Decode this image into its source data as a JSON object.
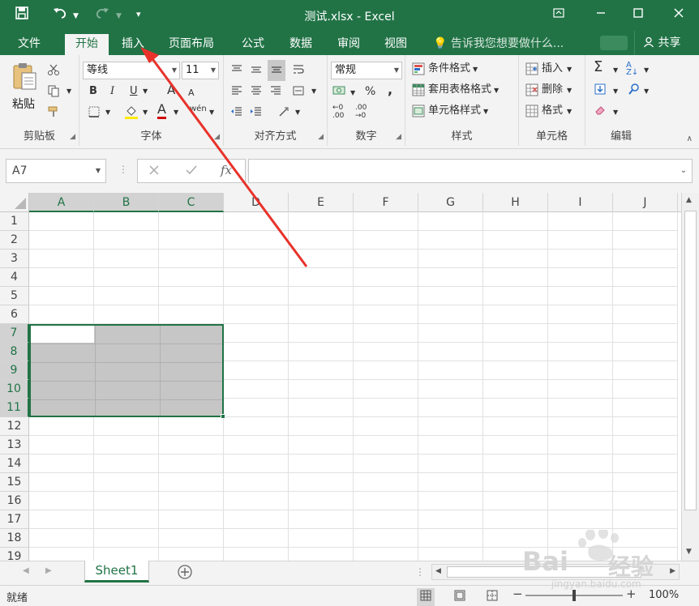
{
  "window": {
    "title": "测试.xlsx - Excel"
  },
  "tabs": [
    {
      "label": "文件"
    },
    {
      "label": "开始",
      "active": true
    },
    {
      "label": "插入"
    },
    {
      "label": "页面布局"
    },
    {
      "label": "公式"
    },
    {
      "label": "数据"
    },
    {
      "label": "审阅"
    },
    {
      "label": "视图"
    }
  ],
  "tellme": {
    "placeholder": "告诉我您想要做什么..."
  },
  "share": {
    "label": "共享"
  },
  "ribbon": {
    "clipboard": {
      "label": "剪贴板",
      "paste": "粘贴"
    },
    "font": {
      "label": "字体",
      "family": "等线",
      "size": "11",
      "bold": "B",
      "italic": "I",
      "underline": "U",
      "grow": "A",
      "shrink": "A",
      "fontcolor": "A",
      "phonetic": "wén"
    },
    "alignment": {
      "label": "对齐方式"
    },
    "number": {
      "label": "数字",
      "format": "常规",
      "percent": "%",
      "comma": ","
    },
    "styles": {
      "label": "样式",
      "conditional": "条件格式",
      "table": "套用表格格式",
      "cell": "单元格样式"
    },
    "cells": {
      "label": "单元格",
      "insert": "插入",
      "delete": "删除",
      "format": "格式"
    },
    "editing": {
      "label": "编辑"
    }
  },
  "formula_bar": {
    "namebox": "A7",
    "fx": "fx",
    "value": ""
  },
  "columns": [
    "A",
    "B",
    "C",
    "D",
    "E",
    "F",
    "G",
    "H",
    "I",
    "J"
  ],
  "rows": [
    "1",
    "2",
    "3",
    "4",
    "5",
    "6",
    "7",
    "8",
    "9",
    "10",
    "11",
    "12",
    "13",
    "14",
    "15",
    "16",
    "17",
    "18",
    "19"
  ],
  "selection": {
    "range": "A7:C11",
    "active_cell": "A7"
  },
  "sheets": [
    {
      "name": "Sheet1",
      "active": true
    }
  ],
  "status": {
    "ready": "就绪",
    "zoom": "100%"
  },
  "watermark": {
    "text1": "Bai",
    "text2": "经验",
    "url": "jingyan.baidu.com"
  },
  "colors": {
    "excel_green": "#217346",
    "arrow": "#e8322a",
    "selection_fill": "#c6c6c6"
  }
}
